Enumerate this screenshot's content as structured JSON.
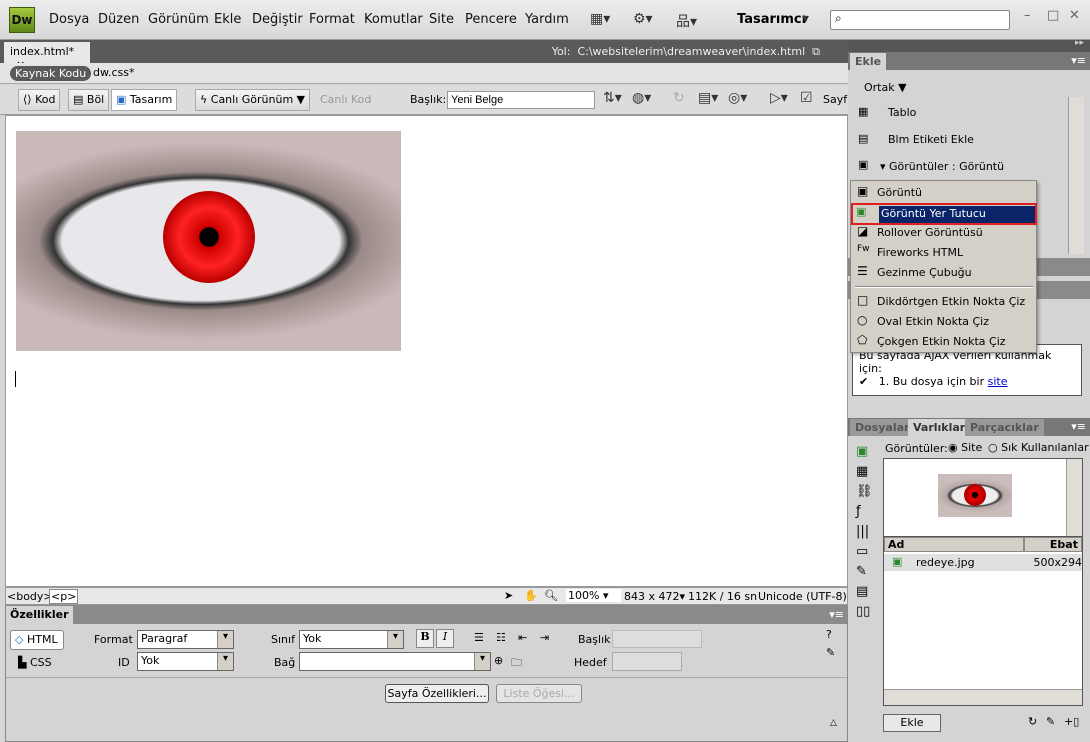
{
  "app": {
    "logo": "Dw",
    "menus": [
      "Dosya",
      "Düzen",
      "Görünüm",
      "Ekle",
      "Değiştir",
      "Format",
      "Komutlar",
      "Site",
      "Pencere",
      "Yardım"
    ],
    "workspace": "Tasarımcı",
    "search_placeholder": "",
    "window_controls": [
      "–",
      "□",
      "✕"
    ]
  },
  "document": {
    "tab": "index.html*",
    "tab_close": "×",
    "path_label": "Yol:",
    "path": "C:\\websitelerim\\dreamweaver\\index.html",
    "source_button": "Kaynak Kodu",
    "related_file": "dw.css*"
  },
  "toolbar": {
    "code": "Kod",
    "split": "Böl",
    "design": "Tasarım",
    "live_view": "Canlı Görünüm",
    "live_code": "Canlı Kod",
    "title_label": "Başlık:",
    "title_value": "Yeni Belge",
    "page_trunc": "Sayf"
  },
  "status": {
    "tags": [
      "<body>",
      "<p>"
    ],
    "zoom": "100%",
    "size": "843 x 472",
    "download": "112K / 16 sn",
    "encoding": "Unicode (UTF-8)"
  },
  "properties": {
    "title": "Özellikler",
    "html": "HTML",
    "css": "CSS",
    "format_label": "Format",
    "format_value": "Paragraf",
    "id_label": "ID",
    "id_value": "Yok",
    "class_label": "Sınıf",
    "class_value": "Yok",
    "link_label": "Bağ",
    "link_value": "",
    "bold": "B",
    "italic": "I",
    "title_label": "Başlık",
    "target_label": "Hedef",
    "page_props": "Sayfa Özellikleri...",
    "list_item": "Liste Öğesi..."
  },
  "insert_panel": {
    "title": "Ekle",
    "category": "Ortak",
    "items": [
      "Tablo",
      "Blm Etiketi Ekle",
      "Görüntüler : Görüntü"
    ]
  },
  "popup": {
    "items": [
      "Görüntü",
      "Görüntü Yer Tutucu",
      "Rollover Görüntüsü",
      "Fireworks HTML",
      "Gezinme Çubuğu"
    ],
    "hotspots": [
      "Dikdörtgen Etkin Nokta Çiz",
      "Oval Etkin Nokta Çiz",
      "Çokgen Etkin Nokta Çiz"
    ],
    "selected": "Görüntü Yer Tutucu",
    "highlight_color": "#e02020"
  },
  "ajax": {
    "text": "Bu sayfada AJAX verileri kullanmak için:",
    "step": "1.  Bu dosya için bir",
    "link": "site"
  },
  "assets": {
    "tabs": [
      "Dosyalar",
      "Varlıklar",
      "Parçacıklar"
    ],
    "active_tab": "Varlıklar",
    "images_label": "Görüntüler:",
    "radio_site": "Site",
    "radio_fav": "Sık Kullanılanlar",
    "site_selected": true,
    "col_name": "Ad",
    "col_size": "Ebat",
    "files": [
      {
        "name": "redeye.jpg",
        "size": "500x294"
      }
    ],
    "insert_button": "Ekle"
  }
}
